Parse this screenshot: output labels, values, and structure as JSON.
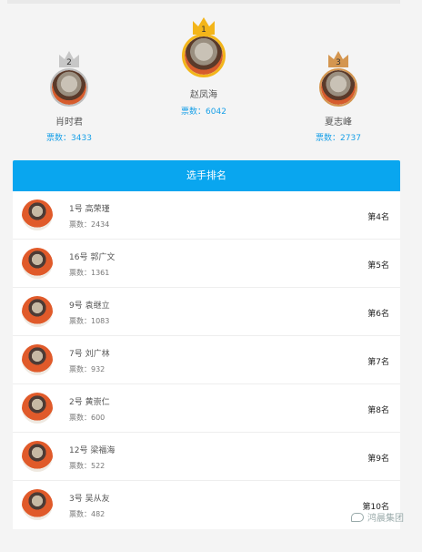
{
  "podium": {
    "first": {
      "rank": "1",
      "name": "赵凤海",
      "votes": "票数：6042"
    },
    "second": {
      "rank": "2",
      "name": "肖时君",
      "votes": "票数：3433"
    },
    "third": {
      "rank": "3",
      "name": "夏志峰",
      "votes": "票数：2737"
    }
  },
  "ranking": {
    "header": "选手排名",
    "rows": [
      {
        "name": "1号 高荣瑾",
        "votes": "票数：2434",
        "rank": "第4名"
      },
      {
        "name": "16号 郭广文",
        "votes": "票数：1361",
        "rank": "第5名"
      },
      {
        "name": "9号 袁继立",
        "votes": "票数：1083",
        "rank": "第6名"
      },
      {
        "name": "7号 刘广林",
        "votes": "票数：932",
        "rank": "第7名"
      },
      {
        "name": "2号 黄崇仁",
        "votes": "票数：600",
        "rank": "第8名"
      },
      {
        "name": "12号 梁福海",
        "votes": "票数：522",
        "rank": "第9名"
      },
      {
        "name": "3号 吴从友",
        "votes": "票数：482",
        "rank": "第10名"
      }
    ]
  },
  "watermark": {
    "text": "鸿晨集团"
  },
  "colors": {
    "accent": "#09a6ef",
    "gold": "#f3b51a",
    "silver": "#b9b9b9",
    "bronze": "#d49650"
  }
}
